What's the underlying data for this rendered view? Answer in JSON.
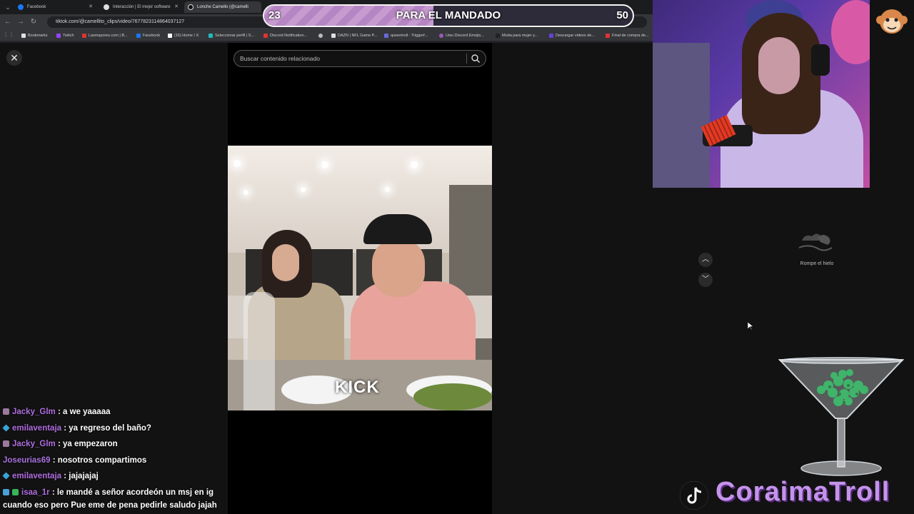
{
  "browser": {
    "tabs": [
      {
        "label": "Facebook",
        "favicon_color": "#1877f2"
      },
      {
        "label": "Interacción | El mejor software",
        "favicon_color": "#dddddd"
      },
      {
        "label": "Lonche Camello (@camelli",
        "favicon_color": "#111111"
      }
    ],
    "url": "tiktok.com/@camellito_clips/video/7677823114864037127",
    "bookmarks": [
      {
        "label": "Bookmarks",
        "color": "#e0e0e0"
      },
      {
        "label": "Twitch",
        "color": "#9146ff"
      },
      {
        "label": "Lasmayores.com | B...",
        "color": "#d33"
      },
      {
        "label": "Facebook",
        "color": "#1877f2"
      },
      {
        "label": "(16) Home / X",
        "color": "#ffffff"
      },
      {
        "label": "Seleccionar perfil | S...",
        "color": "#2bb"
      },
      {
        "label": "Discord Notification...",
        "color": "#d33"
      },
      {
        "label": "",
        "color": "#bbb"
      },
      {
        "label": "DAZN | NFL Game P...",
        "color": "#e0e0e0"
      },
      {
        "label": "queentroll - Triggerf...",
        "color": "#6a6ad8"
      },
      {
        "label": "Uwu Discord Emojis...",
        "color": "#9b59b6"
      },
      {
        "label": "Moda para mujer y...",
        "color": "#222"
      },
      {
        "label": "Descargar videos de...",
        "color": "#6a40d8"
      },
      {
        "label": "Final de compra de...",
        "color": "#d33"
      }
    ]
  },
  "goal": {
    "current": "23",
    "title": "PARA EL MANDADO",
    "target": "50",
    "progress": 0.46
  },
  "tiktok": {
    "search_placeholder": "Buscar contenido relacionado",
    "video_watermark": "KICK",
    "icebreaker_label": "Rompe el hielo"
  },
  "chat": [
    {
      "badge": "sq",
      "user": "Jacky_Glm",
      "message": ": a we yaaaaa"
    },
    {
      "badge": "gem",
      "user": "emilaventaja",
      "message": ": ya regreso del baño?"
    },
    {
      "badge": "sq",
      "user": "Jacky_Glm",
      "message": ": ya empezaron"
    },
    {
      "badge": "",
      "user": "Joseurias69",
      "message": ": nosotros compartimos"
    },
    {
      "badge": "gem",
      "user": "emilaventaja",
      "message": ": jajajajaj"
    },
    {
      "badge": "multi",
      "user": "isaa_1r",
      "message": ": le mandé a señor acordeón un msj en ig"
    },
    {
      "badge": "",
      "user": "",
      "message": "cuando eso pero Pue eme de pena pedirle saludo jajah"
    }
  ],
  "streamer": {
    "name": "CoraimaTroll"
  },
  "colors": {
    "accent": "#c493ea",
    "chat_user": "#b06ee0"
  }
}
